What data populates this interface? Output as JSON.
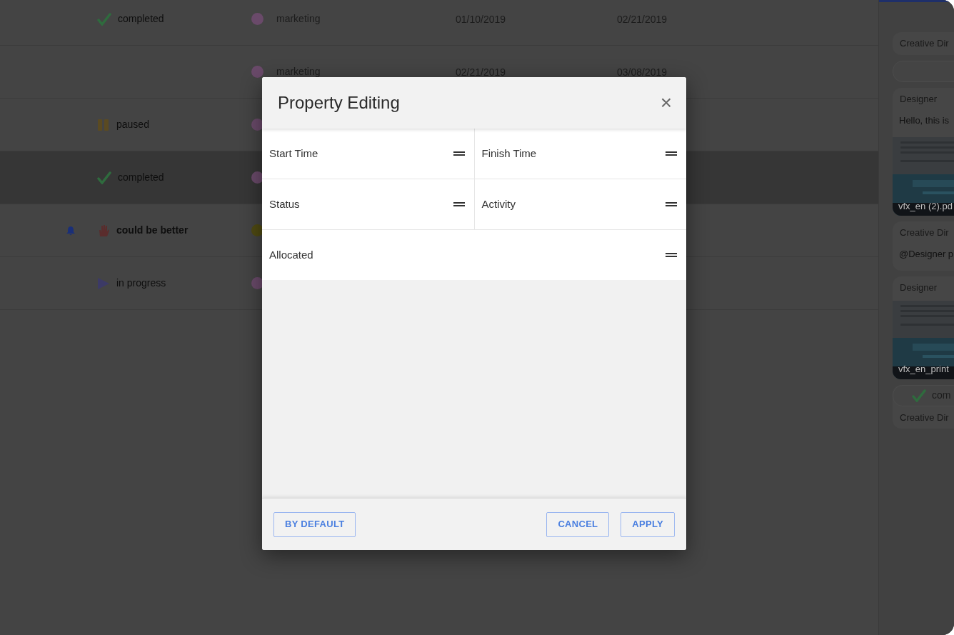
{
  "table": {
    "rows": [
      {
        "selected": false,
        "alert": false,
        "status": {
          "kind": "completed",
          "label": "completed"
        },
        "color": "#6a4a6a",
        "department": "marketing",
        "start": "01/10/2019",
        "finish": "02/21/2019"
      },
      {
        "selected": false,
        "alert": false,
        "color": "#6a4a6a",
        "department": "marketing",
        "start": "02/21/2019",
        "finish": "03/08/2019"
      },
      {
        "selected": false,
        "alert": false,
        "status": {
          "kind": "paused",
          "label": "paused"
        },
        "color": "#6a4a6a"
      },
      {
        "selected": true,
        "alert": false,
        "status": {
          "kind": "completed",
          "label": "completed"
        },
        "color": "#6a4a6a"
      },
      {
        "selected": false,
        "alert": true,
        "status": {
          "kind": "could-be-better",
          "label": "could be better"
        },
        "color": "#4f4a12"
      },
      {
        "selected": false,
        "alert": false,
        "status": {
          "kind": "in-progress",
          "label": "in progress"
        },
        "color": "#6a4a6a"
      }
    ]
  },
  "side_panel": {
    "items": [
      {
        "kind": "author",
        "author": "Creative Dir"
      },
      {
        "kind": "input"
      },
      {
        "kind": "card",
        "author": "Designer",
        "text": "Hello, this is",
        "file": "vfx_en (2).pd"
      },
      {
        "kind": "card",
        "author": "Creative Dir",
        "text": "@Designer p"
      },
      {
        "kind": "card",
        "author": "Designer",
        "file": "vfx_en_print"
      },
      {
        "kind": "status",
        "status": "com",
        "author": "Creative Dir"
      }
    ]
  },
  "dialog": {
    "title": "Property Editing",
    "close": "×",
    "rows": [
      [
        "Start Time",
        "Finish Time"
      ],
      [
        "Status",
        "Activity"
      ],
      [
        "Allocated"
      ]
    ],
    "left_buttons": [
      "BY DEFAULT"
    ],
    "right_buttons": [
      "CANCEL",
      "APPLY"
    ]
  }
}
